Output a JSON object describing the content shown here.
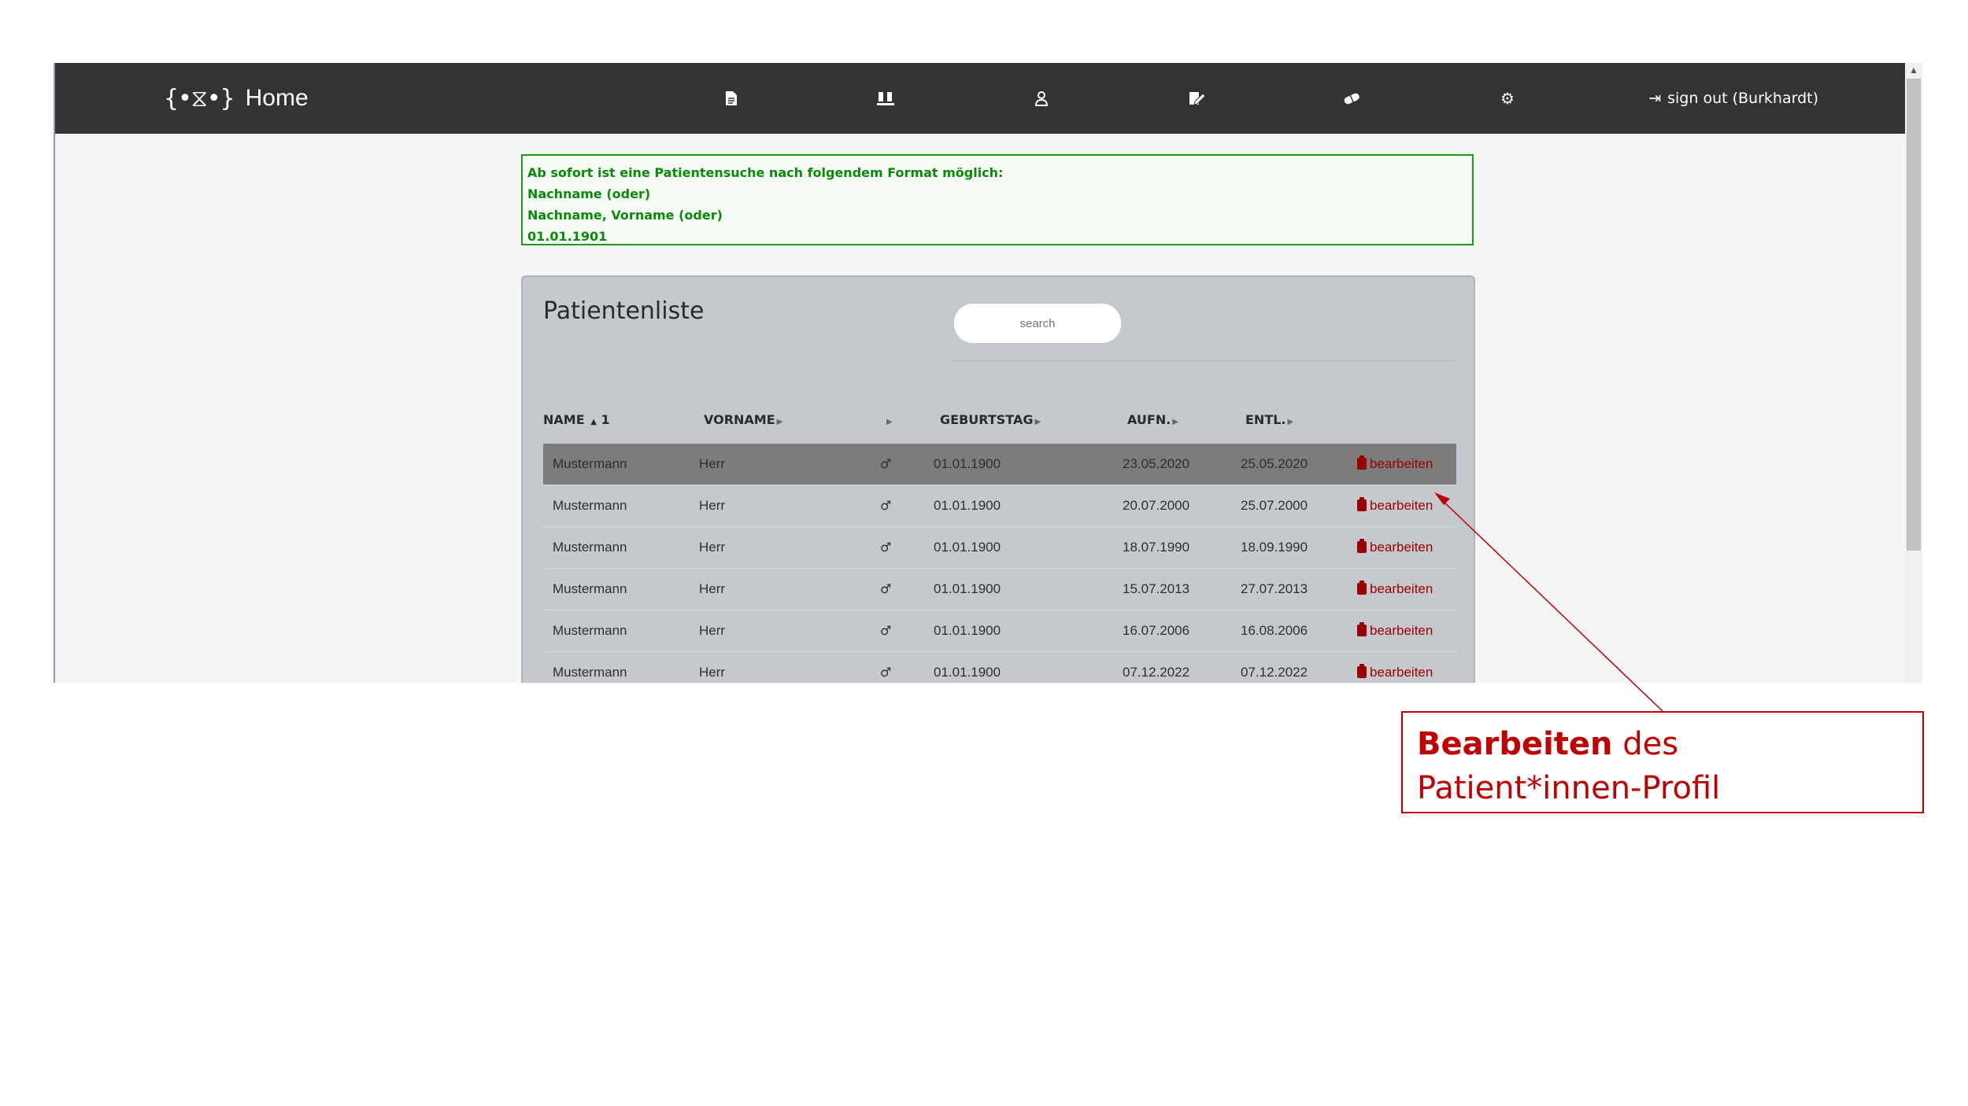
{
  "navbar": {
    "brand_logo": "{•⧖•}",
    "title": "Home",
    "icons": [
      "document-icon",
      "lab-icon",
      "user-icon",
      "edit-icon",
      "pill-icon",
      "gear-icon"
    ],
    "signout_label": "sign out (Burkhardt)"
  },
  "notice": {
    "lines": [
      "Ab sofort ist eine Patientensuche nach folgendem Format möglich:",
      "Nachname (oder)",
      "Nachname, Vorname (oder)",
      "01.01.1901"
    ]
  },
  "patient_list": {
    "title": "Patientenliste",
    "search_placeholder": "search",
    "columns": {
      "name": "NAME",
      "name_sort": "1",
      "vorname": "VORNAME",
      "geburtstag": "GEBURTSTAG",
      "aufn": "AUFN.",
      "entl": "ENTL."
    },
    "rows": [
      {
        "name": "Mustermann",
        "vorname": "Herr",
        "sex": "♂",
        "geburtstag": "01.01.1900",
        "aufn": "23.05.2020",
        "entl": "25.05.2020",
        "action": "bearbeiten"
      },
      {
        "name": "Mustermann",
        "vorname": "Herr",
        "sex": "♂",
        "geburtstag": "01.01.1900",
        "aufn": "20.07.2000",
        "entl": "25.07.2000",
        "action": "bearbeiten"
      },
      {
        "name": "Mustermann",
        "vorname": "Herr",
        "sex": "♂",
        "geburtstag": "01.01.1900",
        "aufn": "18.07.1990",
        "entl": "18.09.1990",
        "action": "bearbeiten"
      },
      {
        "name": "Mustermann",
        "vorname": "Herr",
        "sex": "♂",
        "geburtstag": "01.01.1900",
        "aufn": "15.07.2013",
        "entl": "27.07.2013",
        "action": "bearbeiten"
      },
      {
        "name": "Mustermann",
        "vorname": "Herr",
        "sex": "♂",
        "geburtstag": "01.01.1900",
        "aufn": "16.07.2006",
        "entl": "16.08.2006",
        "action": "bearbeiten"
      },
      {
        "name": "Mustermann",
        "vorname": "Herr",
        "sex": "♂",
        "geburtstag": "01.01.1900",
        "aufn": "07.12.2022",
        "entl": "07.12.2022",
        "action": "bearbeiten"
      }
    ]
  },
  "callout": {
    "bold": "Bearbeiten",
    "text": " des Patient*innen-Profil"
  },
  "colors": {
    "navbar": "#333333",
    "notice_green": "#1a9c1a",
    "edit_red": "#9b0000",
    "callout_red": "#c00000"
  }
}
